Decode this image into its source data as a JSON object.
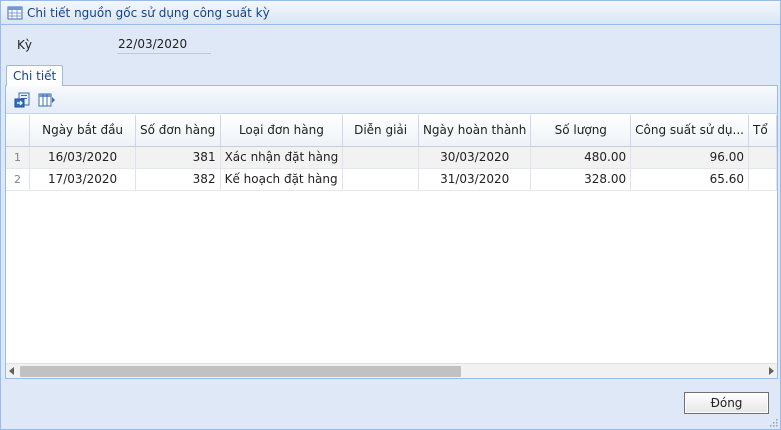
{
  "window": {
    "title": "Chi tiết nguồn gốc sử dụng công suất kỳ",
    "title_icon": "table-window-icon"
  },
  "period": {
    "label": "Kỳ",
    "value": "22/03/2020"
  },
  "tabs": [
    {
      "label": "Chi tiết",
      "active": true
    }
  ],
  "toolbar": {
    "buttons": [
      {
        "icon": "export-icon"
      },
      {
        "icon": "column-chooser-icon"
      }
    ]
  },
  "grid": {
    "columns": [
      "",
      "Ngày bắt đầu",
      "Số đơn hàng",
      "Loại đơn hàng",
      "Diễn giải",
      "Ngày hoàn thành",
      "Số lượng",
      "Công suất sử dụ...",
      "Tổ"
    ],
    "rows": [
      {
        "no": "1",
        "start_date": "16/03/2020",
        "order_no": "381",
        "order_type": "Xác nhận đặt hàng",
        "description": "",
        "finish_date": "30/03/2020",
        "quantity": "480.00",
        "capacity": "96.00"
      },
      {
        "no": "2",
        "start_date": "17/03/2020",
        "order_no": "382",
        "order_type": "Kế hoạch đặt hàng",
        "description": "",
        "finish_date": "31/03/2020",
        "quantity": "328.00",
        "capacity": "65.60"
      }
    ]
  },
  "footer": {
    "close_label": "Đóng"
  },
  "colors": {
    "frame_bg": "#dfe8f6",
    "border": "#99bbe8",
    "title_text": "#15428b"
  }
}
